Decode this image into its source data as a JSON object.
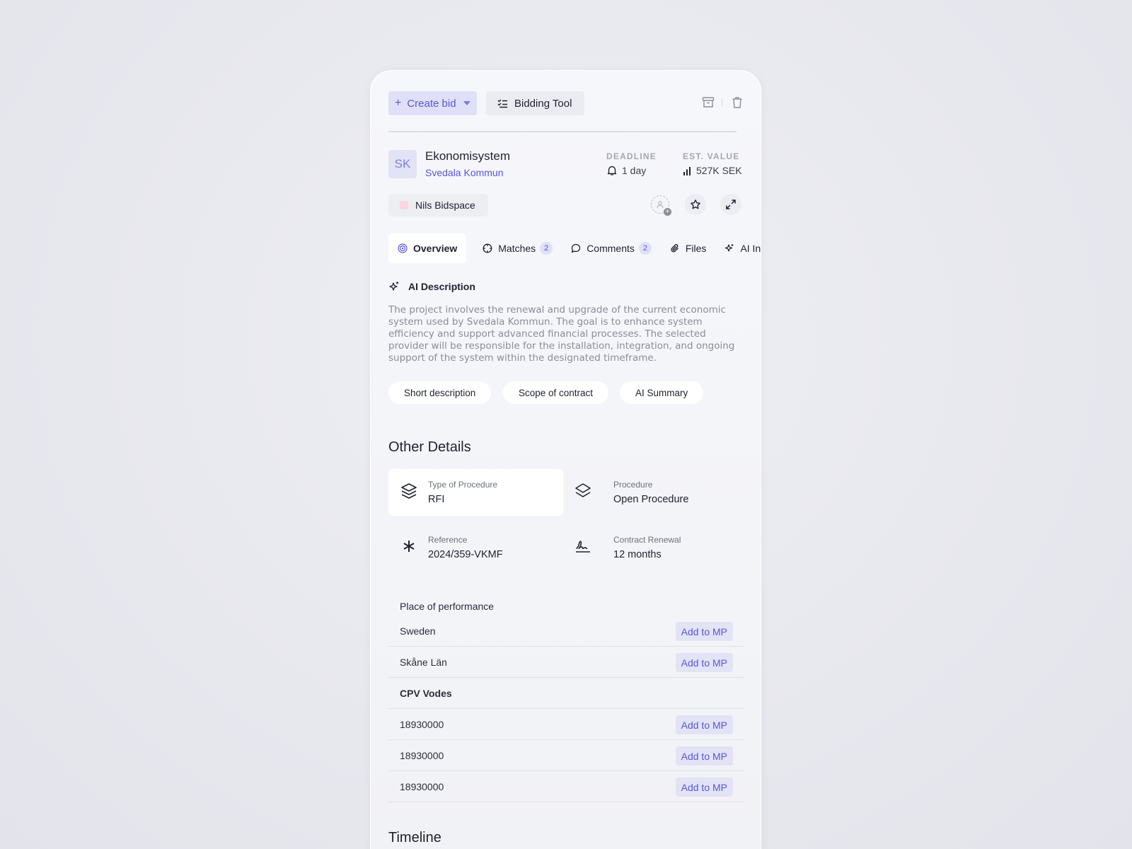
{
  "toolbar": {
    "create_label": "Create bid",
    "tool_label": "Bidding Tool",
    "archive_icon": "archive-icon",
    "delete_icon": "trash-icon"
  },
  "tender": {
    "initials": "SK",
    "title": "Ekonomisystem",
    "organization": "Svedala Kommun",
    "deadline_label": "DEADLINE",
    "deadline_value": "1 day",
    "value_label": "EST. VALUE",
    "value_value": "527K SEK"
  },
  "workspace": {
    "name": "Nils Bidspace"
  },
  "tabs": [
    {
      "label": "Overview",
      "icon": "target-icon",
      "active": true
    },
    {
      "label": "Matches",
      "icon": "crosshair-icon",
      "count": "2"
    },
    {
      "label": "Comments",
      "icon": "comment-icon",
      "count": "2"
    },
    {
      "label": "Files",
      "icon": "paperclip-icon"
    },
    {
      "label": "AI Insig",
      "icon": "sparkles-icon"
    }
  ],
  "ai": {
    "heading": "AI Description",
    "description": "The project involves the renewal and upgrade of the current economic system used by Svedala Kommun. The goal is to enhance system efficiency and support advanced financial processes. The selected provider will be responsible for the installation, integration, and ongoing support of the system within the designated timeframe.",
    "pills": [
      "Short description",
      "Scope of contract",
      "AI Summary"
    ]
  },
  "other_details": {
    "heading": "Other Details",
    "items": [
      {
        "label": "Type of Procedure",
        "value": "RFI",
        "icon": "layers-icon"
      },
      {
        "label": "Procedure",
        "value": "Open Procedure",
        "icon": "layers-icon"
      },
      {
        "label": "Reference",
        "value": "2024/359-VKMF",
        "icon": "asterisk-icon"
      },
      {
        "label": "Contract Renewal",
        "value": "12 months",
        "icon": "signature-icon"
      }
    ]
  },
  "place": {
    "heading": "Place of performance",
    "rows": [
      "Sweden",
      "Skåne Län"
    ],
    "add_label": "Add to MP"
  },
  "cpv": {
    "heading": "CPV Vodes",
    "rows": [
      "18930000",
      "18930000",
      "18930000"
    ]
  },
  "timeline": {
    "heading": "Timeline"
  },
  "colors": {
    "accent": "#5856d6",
    "accent_bg": "#dfe0f7"
  }
}
